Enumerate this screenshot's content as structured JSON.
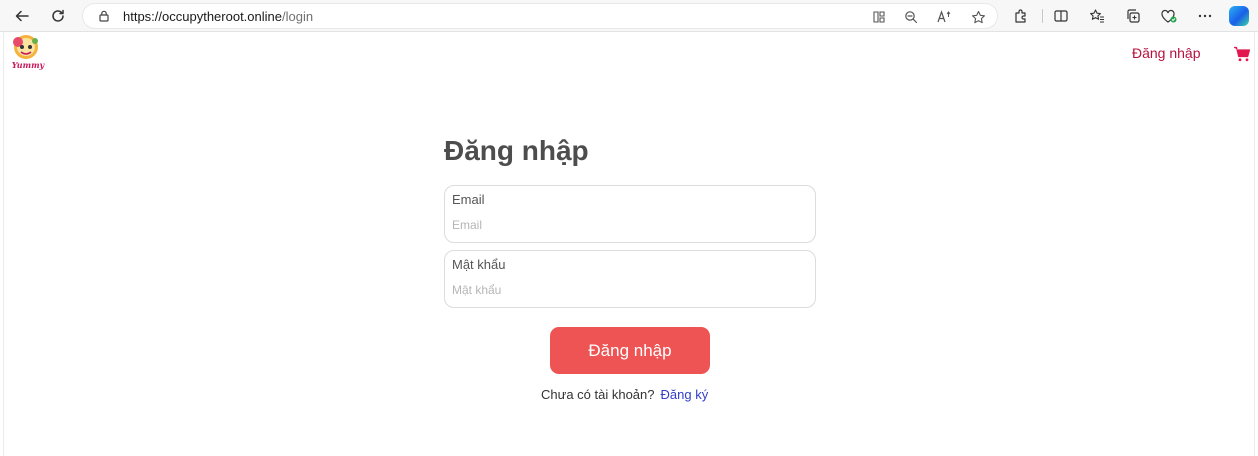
{
  "browser": {
    "url_host": "https://occupytheroot.online",
    "url_path": "/login"
  },
  "header": {
    "logo_text": "Yummy",
    "login_link": "Đăng nhập"
  },
  "login": {
    "title": "Đăng nhập",
    "email_label": "Email",
    "email_placeholder": "Email",
    "email_value": "",
    "password_label": "Mật khẩu",
    "password_placeholder": "Mật khẩu",
    "password_value": "",
    "submit_label": "Đăng nhập",
    "no_account_text": "Chưa có tài khoản?",
    "signup_link": "Đăng ký"
  },
  "colors": {
    "accent": "#ed5453",
    "header_link": "#b5123f",
    "signup_link": "#3340c4"
  },
  "icons": [
    "back-icon",
    "refresh-icon",
    "lock-icon",
    "immersive-reader-icon",
    "zoom-out-icon",
    "read-aloud-icon",
    "favorite-star-icon",
    "extensions-icon",
    "split-screen-icon",
    "favorites-icon",
    "collections-icon",
    "browser-essentials-icon",
    "more-icon",
    "copilot-icon",
    "cart-icon"
  ]
}
